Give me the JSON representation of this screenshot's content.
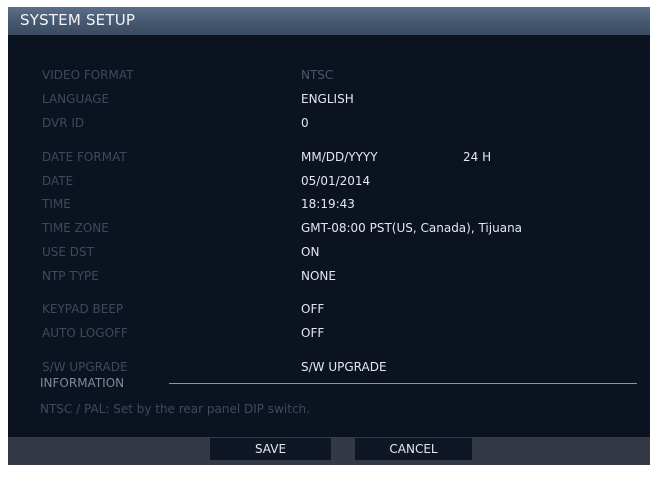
{
  "window": {
    "title": "SYSTEM SETUP"
  },
  "settings": [
    {
      "label": "VIDEO FORMAT",
      "value": "NTSC",
      "enabled": false
    },
    {
      "label": "LANGUAGE",
      "value": "ENGLISH",
      "enabled": true
    },
    {
      "label": "DVR ID",
      "value": "0",
      "enabled": true
    },
    {
      "label": "DATE FORMAT",
      "value": "MM/DD/YYYY",
      "value2": "24 H",
      "enabled": true
    },
    {
      "label": "DATE",
      "value": "05/01/2014",
      "enabled": true
    },
    {
      "label": "TIME",
      "value": "18:19:43",
      "enabled": true
    },
    {
      "label": "TIME ZONE",
      "value": "GMT-08:00 PST(US, Canada), Tijuana",
      "enabled": true
    },
    {
      "label": "USE DST",
      "value": "ON",
      "enabled": true
    },
    {
      "label": "NTP TYPE",
      "value": "NONE",
      "enabled": true
    },
    {
      "label": "KEYPAD BEEP",
      "value": "OFF",
      "enabled": true
    },
    {
      "label": "AUTO LOGOFF",
      "value": "OFF",
      "enabled": true
    },
    {
      "label": "S/W UPGRADE",
      "value": "S/W UPGRADE",
      "enabled": true
    }
  ],
  "information": {
    "label": "INFORMATION",
    "text": "NTSC / PAL: Set by the rear panel DIP switch."
  },
  "footer": {
    "save_label": "SAVE",
    "cancel_label": "CANCEL"
  }
}
